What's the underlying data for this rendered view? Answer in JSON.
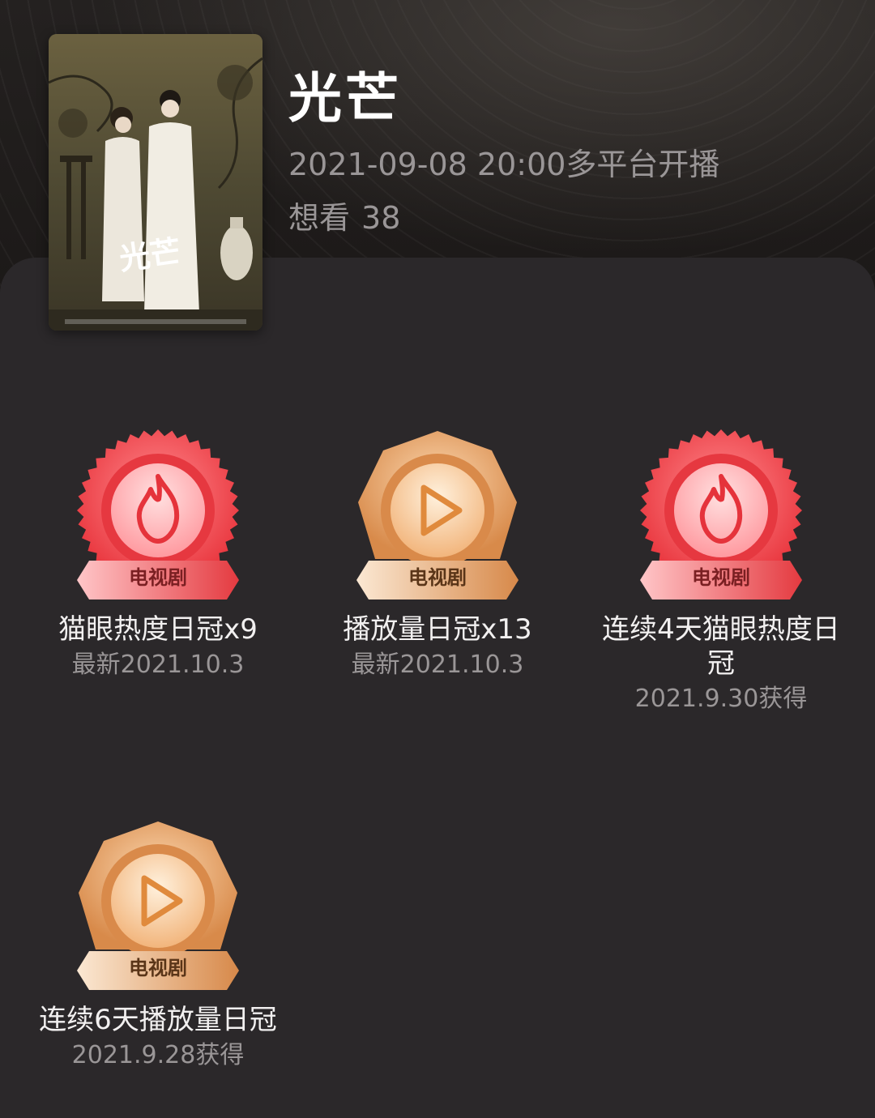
{
  "show": {
    "title": "光芒",
    "release": "2021-09-08 20:00多平台开播",
    "want_label": "想看",
    "want_count": "38",
    "poster_logo": "光芒"
  },
  "colors": {
    "red_badge": "#e8323a",
    "gold_badge": "#e0a065",
    "background": "#2b282a"
  },
  "badges": [
    {
      "kind": "hot",
      "icon": "flame-icon",
      "tag": "电视剧",
      "name": "猫眼热度日冠x9",
      "date": "最新2021.10.3"
    },
    {
      "kind": "play",
      "icon": "play-icon",
      "tag": "电视剧",
      "name": "播放量日冠x13",
      "date": "最新2021.10.3"
    },
    {
      "kind": "hot",
      "icon": "flame-icon",
      "tag": "电视剧",
      "name": "连续4天猫眼热度日冠",
      "date": "2021.9.30获得"
    },
    {
      "kind": "play",
      "icon": "play-icon",
      "tag": "电视剧",
      "name": "连续6天播放量日冠",
      "date": "2021.9.28获得"
    }
  ]
}
